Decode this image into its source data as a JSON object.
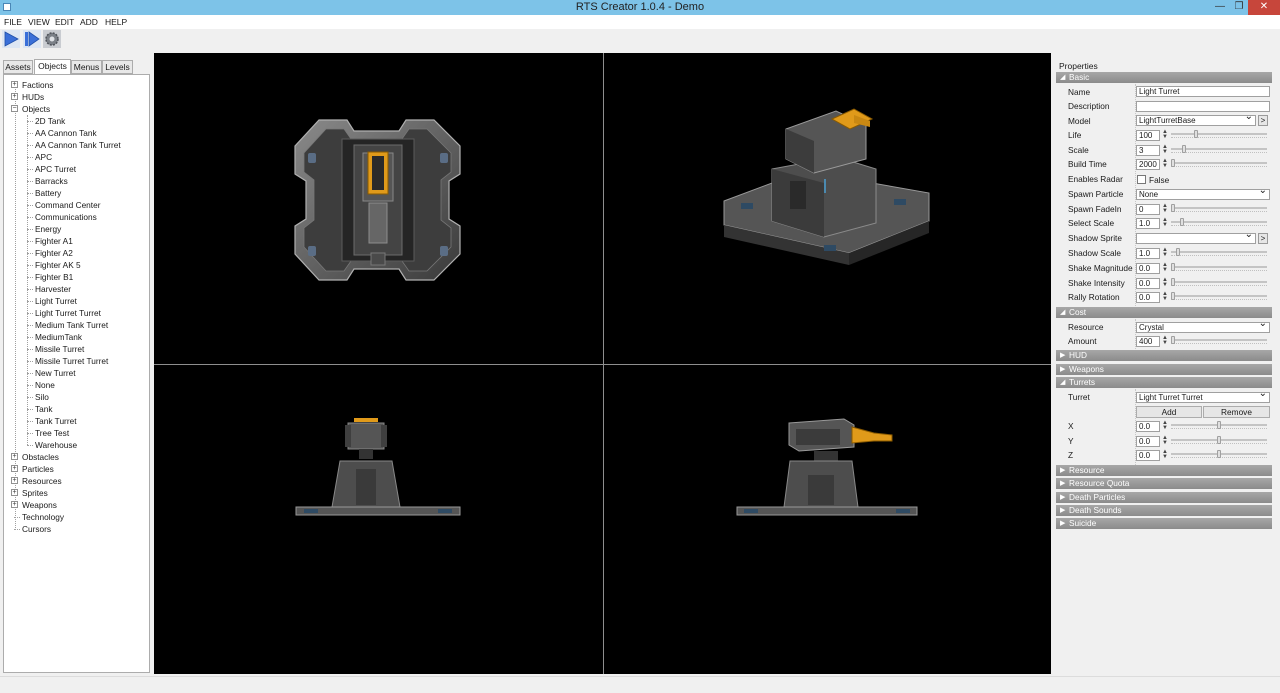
{
  "window": {
    "title": "RTS Creator 1.0.4  - Demo",
    "minimize": "—",
    "maximize": "❐",
    "close": "✕"
  },
  "menu": [
    "FILE",
    "VIEW",
    "EDIT",
    "ADD",
    "HELP"
  ],
  "toolbar": {
    "buttons": [
      "play-icon",
      "play-step-icon",
      "settings-gear-icon"
    ],
    "colors": {
      "accent": "#3a6fd8"
    }
  },
  "tabs": [
    "Assets",
    "Objects",
    "Menus",
    "Levels"
  ],
  "active_tab": "Objects",
  "tree": {
    "top": [
      {
        "label": "Factions",
        "expand": "+"
      },
      {
        "label": "HUDs",
        "expand": "+"
      },
      {
        "label": "Objects",
        "expand": "−"
      }
    ],
    "objects": [
      "2D Tank",
      "AA Cannon Tank",
      "AA Cannon Tank Turret",
      "APC",
      "APC Turret",
      "Barracks",
      "Battery",
      "Command Center",
      "Communications",
      "Energy",
      "Fighter A1",
      "Fighter A2",
      "Fighter AK 5",
      "Fighter B1",
      "Harvester",
      "Light Turret",
      "Light Turret Turret",
      "Medium Tank Turret",
      "MediumTank",
      "Missile Turret",
      "Missile Turret Turret",
      "New Turret",
      "None",
      "Silo",
      "Tank",
      "Tank Turret",
      "Tree Test",
      "Warehouse"
    ],
    "bottom": [
      {
        "label": "Obstacles",
        "expand": "+"
      },
      {
        "label": "Particles",
        "expand": "+"
      },
      {
        "label": "Resources",
        "expand": "+"
      },
      {
        "label": "Sprites",
        "expand": "+"
      },
      {
        "label": "Weapons",
        "expand": "+"
      },
      {
        "label": "Technology",
        "expand": ""
      },
      {
        "label": "Cursors",
        "expand": ""
      }
    ]
  },
  "properties": {
    "title": "Properties",
    "basic": {
      "header": "Basic",
      "name_label": "Name",
      "name_value": "Light Turret",
      "description_label": "Description",
      "description_value": "",
      "model_label": "Model",
      "model_value": "LightTurretBase",
      "model_btn": ">",
      "life_label": "Life",
      "life_value": "100",
      "life_level": 0.25,
      "scale_label": "Scale",
      "scale_value": "3",
      "scale_level": 0.12,
      "buildtime_label": "Build Time",
      "buildtime_value": "2000",
      "buildtime_level": 0.0,
      "radar_label": "Enables Radar",
      "radar_value": "False",
      "spawnparticle_label": "Spawn Particle",
      "spawnparticle_value": "None",
      "spawnfade_label": "Spawn FadeIn",
      "spawnfade_value": "0",
      "spawnfade_level": 0.0,
      "selectscale_label": "Select Scale",
      "selectscale_value": "1.0",
      "selectscale_level": 0.1,
      "shadowsprite_label": "Shadow Sprite",
      "shadowsprite_value": "",
      "shadowsprite_btn": ">",
      "shadowscale_label": "Shadow Scale",
      "shadowscale_value": "1.0",
      "shadowscale_level": 0.05,
      "shakemag_label": "Shake Magnitude",
      "shakemag_value": "0.0",
      "shakemag_level": 0.0,
      "shakeint_label": "Shake Intensity",
      "shakeint_value": "0.0",
      "shakeint_level": 0.0,
      "rally_label": "Rally Rotation",
      "rally_value": "0.0",
      "rally_level": 0.0
    },
    "cost": {
      "header": "Cost",
      "resource_label": "Resource",
      "resource_value": "Crystal",
      "amount_label": "Amount",
      "amount_value": "400",
      "amount_level": 0.0
    },
    "hud_header": "HUD",
    "weapons_header": "Weapons",
    "turrets": {
      "header": "Turrets",
      "turret_label": "Turret",
      "turret_value": "Light Turret Turret",
      "add_label": "Add",
      "remove_label": "Remove",
      "x_label": "X",
      "x_value": "0.0",
      "x_level": 0.5,
      "y_label": "Y",
      "y_value": "0.0",
      "y_level": 0.5,
      "z_label": "Z",
      "z_value": "0.0",
      "z_level": 0.5
    },
    "collapsed": [
      "Resource",
      "Resource Quota",
      "Death Particles",
      "Death Sounds",
      "Suicide"
    ]
  }
}
